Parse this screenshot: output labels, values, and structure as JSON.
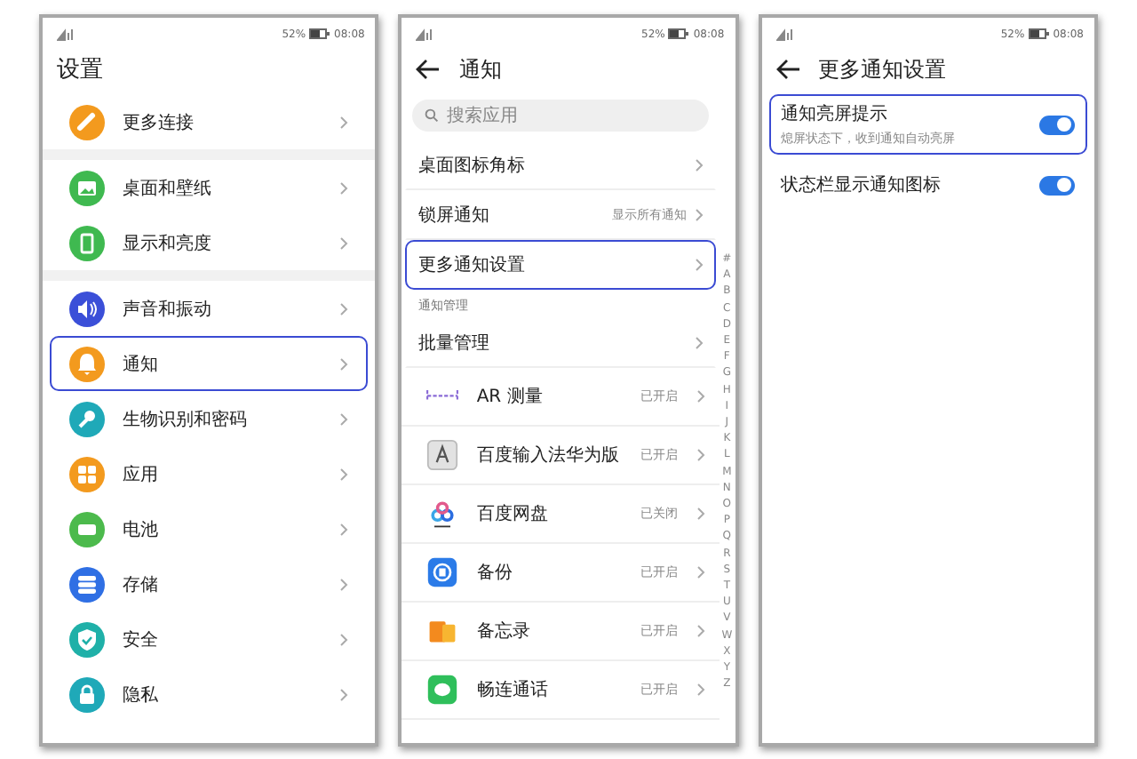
{
  "panels": [
    {
      "kind": "settings",
      "status": {
        "battery": "52%",
        "time": "08:08"
      },
      "title": "设置",
      "back": false,
      "items": [
        {
          "label": "更多连接",
          "color": "#f39a1e",
          "group_start": false,
          "highlighted": false
        },
        {
          "label": "桌面和壁纸",
          "color": "#3fb950",
          "group_start": true,
          "highlighted": false
        },
        {
          "label": "显示和亮度",
          "color": "#3fb950",
          "group_start": false,
          "highlighted": false
        },
        {
          "label": "声音和振动",
          "color": "#3b4fd8",
          "group_start": true,
          "highlighted": false
        },
        {
          "label": "通知",
          "color": "#f39a1e",
          "group_start": false,
          "highlighted": true
        },
        {
          "label": "生物识别和密码",
          "color": "#1fa9b8",
          "group_start": false,
          "highlighted": false
        },
        {
          "label": "应用",
          "color": "#f39a1e",
          "group_start": false,
          "highlighted": false
        },
        {
          "label": "电池",
          "color": "#4cba4c",
          "group_start": false,
          "highlighted": false
        },
        {
          "label": "存储",
          "color": "#2f6fe4",
          "group_start": false,
          "highlighted": false
        },
        {
          "label": "安全",
          "color": "#1fb0a8",
          "group_start": false,
          "highlighted": false
        },
        {
          "label": "隐私",
          "color": "#1fa9b8",
          "group_start": false,
          "highlighted": false
        }
      ]
    },
    {
      "kind": "notifications",
      "status": {
        "battery": "52%",
        "time": "08:08"
      },
      "title": "通知",
      "back": true,
      "search": {
        "placeholder": "搜索应用"
      },
      "rows": [
        {
          "label": "桌面图标角标",
          "highlighted": false
        },
        {
          "label": "锁屏通知",
          "value": "显示所有通知",
          "highlighted": false
        },
        {
          "label": "更多通知设置",
          "highlighted": true
        }
      ],
      "section": "通知管理",
      "batch": "批量管理",
      "apps": [
        {
          "label": "AR 测量",
          "status": "已开启"
        },
        {
          "label": "百度输入法华为版",
          "status": "已开启"
        },
        {
          "label": "百度网盘",
          "status": "已关闭"
        },
        {
          "label": "备份",
          "status": "已开启"
        },
        {
          "label": "备忘录",
          "status": "已开启"
        },
        {
          "label": "畅连通话",
          "status": "已开启"
        }
      ],
      "index": [
        "#",
        "A",
        "B",
        "C",
        "D",
        "E",
        "F",
        "G",
        "H",
        "I",
        "J",
        "K",
        "L",
        "M",
        "N",
        "O",
        "P",
        "Q",
        "R",
        "S",
        "T",
        "U",
        "V",
        "W",
        "X",
        "Y",
        "Z"
      ]
    },
    {
      "kind": "more",
      "status": {
        "battery": "52%",
        "time": "08:08"
      },
      "title": "更多通知设置",
      "back": true,
      "toggles": [
        {
          "label": "通知亮屏提示",
          "description": "熄屏状态下，收到通知自动亮屏",
          "on": true,
          "highlighted": true
        },
        {
          "label": "状态栏显示通知图标",
          "on": true,
          "highlighted": false
        }
      ]
    }
  ]
}
